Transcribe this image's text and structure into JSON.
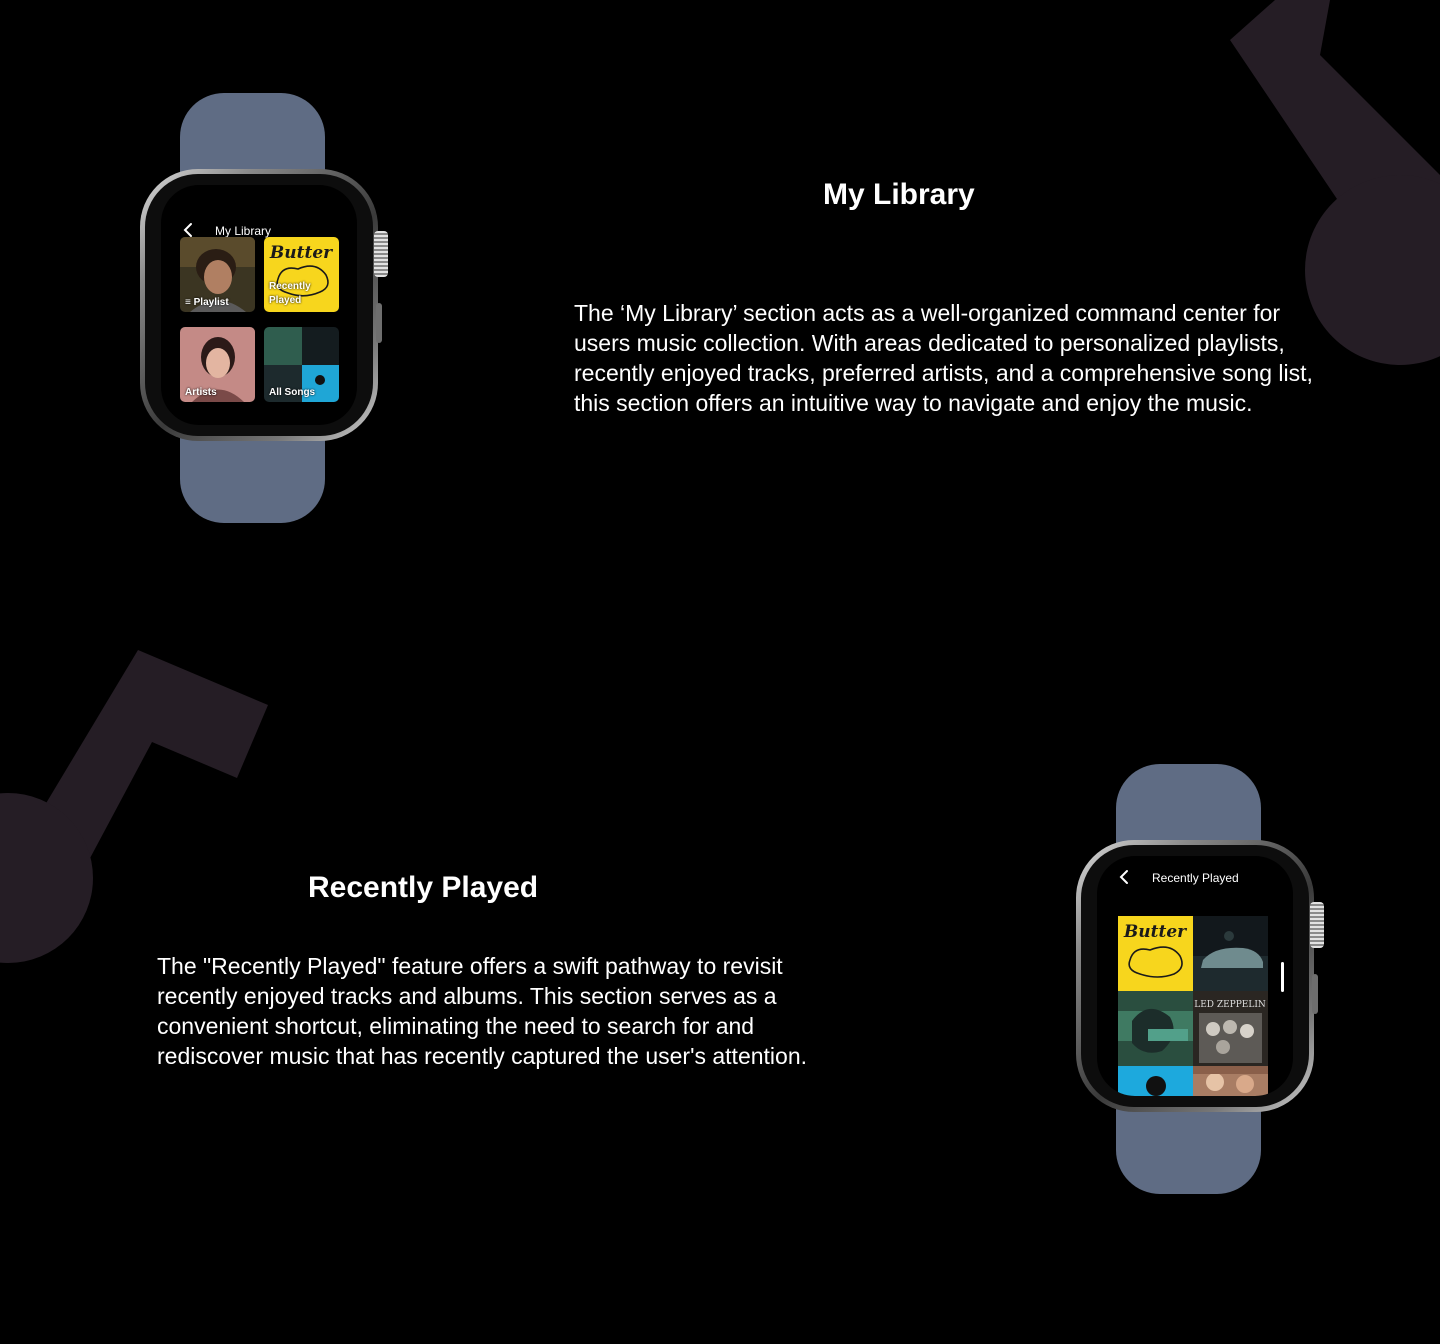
{
  "sections": {
    "my_library": {
      "title": "My Library",
      "description": "The ‘My Library’ section acts as a well-organized command center for users music collection. With areas dedicated to personalized playlists, recently enjoyed tracks, preferred artists, and a comprehensive song list, this section offers an intuitive way to navigate and enjoy the music.",
      "watch": {
        "screen_title": "My Library",
        "tiles": [
          "Playlist",
          "Recently Played",
          "Artists",
          "All Songs"
        ]
      }
    },
    "recently_played": {
      "title": "Recently Played",
      "description": "The \"Recently Played\" feature offers a swift pathway to revisit recently enjoyed tracks and albums. This section serves as a convenient shortcut, eliminating the need to search for and rediscover music that has recently captured the user's attention.",
      "watch": {
        "screen_title": "Recently Played"
      }
    }
  },
  "album_text": {
    "butter": "Butter",
    "zeppelin": "LED ZEPPELIN"
  },
  "colors": {
    "background": "#000000",
    "decor_note": "#251d25",
    "band": "#5f6c84",
    "butter_yellow": "#f7d61d"
  },
  "icons": [
    "music-note-icon",
    "back-chevron-icon",
    "playlist-icon"
  ]
}
